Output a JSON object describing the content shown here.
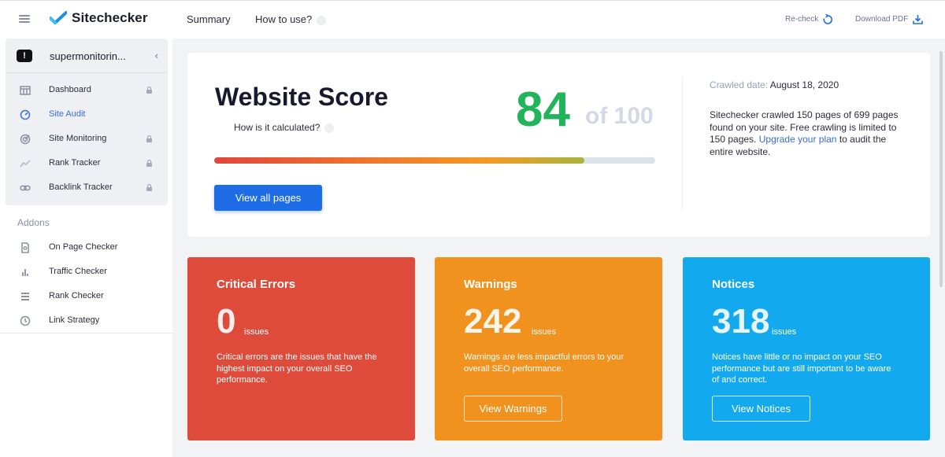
{
  "app": {
    "brand": "Sitechecker"
  },
  "topnav": {
    "summary": "Summary",
    "how_to_use": "How to use?",
    "recheck": "Re-check",
    "download_pdf": "Download PDF"
  },
  "sidebar": {
    "site_badge": "!",
    "site_name": "supermonitorin...",
    "items": [
      {
        "label": "Dashboard",
        "icon": "dashboard-icon",
        "locked": true
      },
      {
        "label": "Site Audit",
        "icon": "gauge-icon",
        "locked": false,
        "active": true
      },
      {
        "label": "Site Monitoring",
        "icon": "radar-icon",
        "locked": true
      },
      {
        "label": "Rank Tracker",
        "icon": "trend-line-icon",
        "locked": true
      },
      {
        "label": "Backlink Tracker",
        "icon": "link-icon",
        "locked": true
      }
    ],
    "addons_title": "Addons",
    "addons": [
      {
        "label": "On Page Checker",
        "icon": "page-search-icon"
      },
      {
        "label": "Traffic Checker",
        "icon": "bar-chart-icon"
      },
      {
        "label": "Rank Checker",
        "icon": "list-icon"
      },
      {
        "label": "Link Strategy",
        "icon": "history-icon"
      }
    ]
  },
  "score": {
    "title": "Website Score",
    "how_calculated": "How is it calculated?",
    "value": "84",
    "of_total": "of 100",
    "progress_percent": 84,
    "view_all_button": "View all pages",
    "crawled_label": "Crawled date:",
    "crawled_date": "August 18, 2020",
    "desc_before": "Sitechecker crawled 150 pages of 699 pages found on your site. Free crawling is limited to 150 pages.",
    "upgrade_link": "Upgrade your plan",
    "desc_after": "to audit the entire website."
  },
  "issues": {
    "critical": {
      "title": "Critical Errors",
      "count": "0",
      "unit": "issues",
      "description": "Critical errors are the issues that have the highest impact on your overall SEO performance.",
      "color": "#de4b3b"
    },
    "warnings": {
      "title": "Warnings",
      "count": "242",
      "unit": "issues",
      "description": "Warnings are less impactful errors to your overall SEO performance.",
      "button": "View Warnings",
      "color": "#f1921f"
    },
    "notices": {
      "title": "Notices",
      "count": "318",
      "unit": "issues",
      "description": "Notices have little or no impact on your SEO performance but are still important to be aware of and correct.",
      "button": "View Notices",
      "color": "#13a9ef"
    }
  },
  "colors": {
    "accent": "#1f6de6",
    "score_green": "#22b45a",
    "link_blue": "#3a6bd8"
  }
}
